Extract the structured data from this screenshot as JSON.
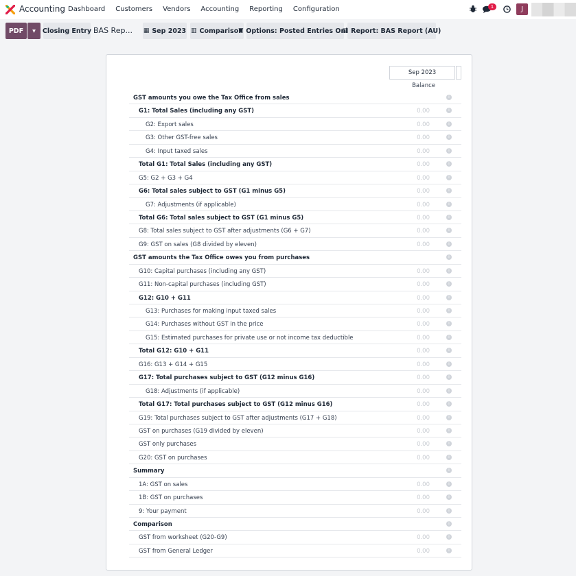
{
  "navbar": {
    "app_name": "Accounting",
    "menu": [
      "Dashboard",
      "Customers",
      "Vendors",
      "Accounting",
      "Reporting",
      "Configuration"
    ],
    "chat_badge": "1",
    "avatar_initial": "J"
  },
  "controls": {
    "pdf_label": "PDF",
    "caret": "▾",
    "closing_entry": "Closing Entry",
    "breadcrumb": "BAS Rep...",
    "date_filter": "Sep 2023",
    "comparison": "Comparison",
    "options": "Options: Posted Entries Only",
    "report": "Report: BAS Report (AU)"
  },
  "report": {
    "column_period": "Sep 2023",
    "column_label": "Balance",
    "rows": [
      {
        "label": "GST amounts you owe the Tax Office from sales",
        "level": "lvl0",
        "value": ""
      },
      {
        "label": "G1: Total Sales (including any GST)",
        "level": "lvl1b",
        "value": "0.00"
      },
      {
        "label": "G2: Export sales",
        "level": "lvl2",
        "value": "0.00"
      },
      {
        "label": "G3: Other GST-free sales",
        "level": "lvl2",
        "value": "0.00"
      },
      {
        "label": "G4: Input taxed sales",
        "level": "lvl2",
        "value": "0.00"
      },
      {
        "label": "Total G1: Total Sales (including any GST)",
        "level": "lvl1b",
        "value": "0.00"
      },
      {
        "label": "G5: G2 + G3 + G4",
        "level": "lvl1",
        "value": "0.00"
      },
      {
        "label": "G6: Total sales subject to GST (G1 minus G5)",
        "level": "lvl1b",
        "value": "0.00"
      },
      {
        "label": "G7: Adjustments (if applicable)",
        "level": "lvl2",
        "value": "0.00"
      },
      {
        "label": "Total G6: Total sales subject to GST (G1 minus G5)",
        "level": "lvl1b",
        "value": "0.00"
      },
      {
        "label": "G8: Total sales subject to GST after adjustments (G6 + G7)",
        "level": "lvl1",
        "value": "0.00"
      },
      {
        "label": "G9: GST on sales (G8 divided by eleven)",
        "level": "lvl1",
        "value": "0.00"
      },
      {
        "label": "GST amounts the Tax Office owes you from purchases",
        "level": "lvl0",
        "value": ""
      },
      {
        "label": "G10: Capital purchases (including any GST)",
        "level": "lvl1",
        "value": "0.00"
      },
      {
        "label": "G11: Non-capital purchases (including GST)",
        "level": "lvl1",
        "value": "0.00"
      },
      {
        "label": "G12: G10 + G11",
        "level": "lvl1b",
        "value": "0.00"
      },
      {
        "label": "G13: Purchases for making input taxed sales",
        "level": "lvl2",
        "value": "0.00"
      },
      {
        "label": "G14: Purchases without GST in the price",
        "level": "lvl2",
        "value": "0.00"
      },
      {
        "label": "G15: Estimated purchases for private use or not income tax deductible",
        "level": "lvl2",
        "value": "0.00"
      },
      {
        "label": "Total G12: G10 + G11",
        "level": "lvl1b",
        "value": "0.00"
      },
      {
        "label": "G16: G13 + G14 + G15",
        "level": "lvl1",
        "value": "0.00"
      },
      {
        "label": "G17: Total purchases subject to GST (G12 minus G16)",
        "level": "lvl1b",
        "value": "0.00"
      },
      {
        "label": "G18: Adjustments (if applicable)",
        "level": "lvl2",
        "value": "0.00"
      },
      {
        "label": "Total G17: Total purchases subject to GST (G12 minus G16)",
        "level": "lvl1b",
        "value": "0.00"
      },
      {
        "label": "G19: Total purchases subject to GST after adjustments (G17 + G18)",
        "level": "lvl1",
        "value": "0.00"
      },
      {
        "label": "GST on purchases (G19 divided by eleven)",
        "level": "lvl1",
        "value": "0.00"
      },
      {
        "label": "GST only purchases",
        "level": "lvl1",
        "value": "0.00"
      },
      {
        "label": "G20: GST on purchases",
        "level": "lvl1",
        "value": "0.00"
      },
      {
        "label": "Summary",
        "level": "lvl0",
        "value": ""
      },
      {
        "label": "1A: GST on sales",
        "level": "lvl1",
        "value": "0.00"
      },
      {
        "label": "1B: GST on purchases",
        "level": "lvl1",
        "value": "0.00"
      },
      {
        "label": "9: Your payment",
        "level": "lvl1",
        "value": "0.00"
      },
      {
        "label": "Comparison",
        "level": "lvl0",
        "value": ""
      },
      {
        "label": "GST from worksheet (G20-G9)",
        "level": "lvl1",
        "value": "0.00"
      },
      {
        "label": "GST from General Ledger",
        "level": "lvl1",
        "value": "0.00"
      }
    ]
  }
}
